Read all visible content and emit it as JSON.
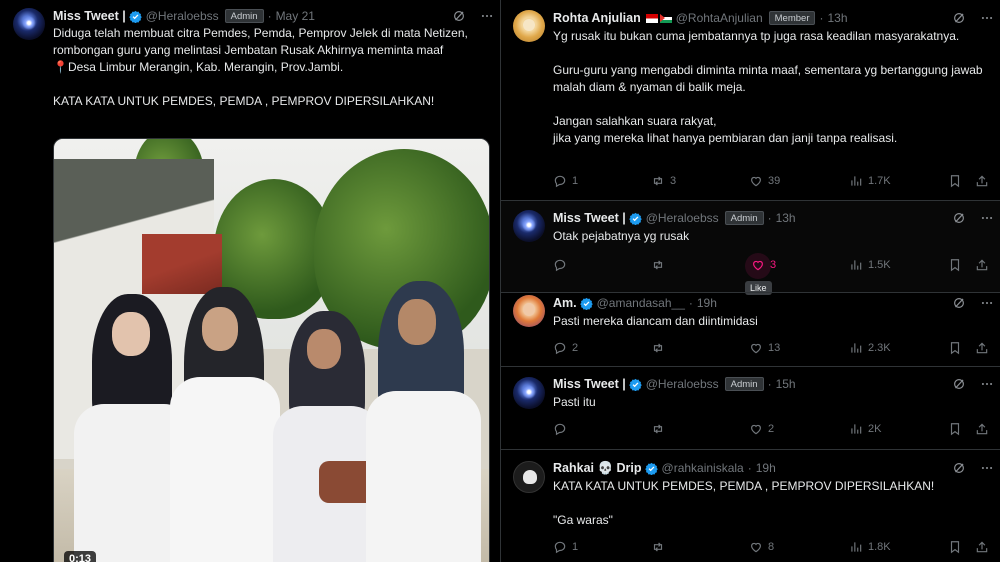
{
  "left_post": {
    "author_name": "Miss Tweet |",
    "handle": "@Heraloebss",
    "badge": "Admin",
    "time": "May 21",
    "text": "Diduga telah membuat citra Pemdes, Pemda, Pemprov Jelek di mata Netizen,  rombongan guru yang melintasi Jembatan Rusak Akhirnya meminta maaf\n📍Desa Limbur Merangin, Kab. Merangin, Prov.Jambi.\n\nKATA KATA UNTUK PEMDES, PEMDA , PEMPROV DIPERSILAHKAN!",
    "video_time": "0:13"
  },
  "replies": [
    {
      "author_name": "Rohta Anjulian",
      "handle": "@RohtaAnjulian",
      "badge": "Member",
      "time": "13h",
      "text": "Yg rusak itu bukan cuma jembatannya tp juga rasa keadilan masyarakatnya.\n\nGuru-guru yang mengabdi diminta minta maaf, sementara yg bertanggung jawab malah diam & nyaman di balik meja.\n\nJangan salahkan suara rakyat,\njika yang mereka lihat hanya pembiaran dan janji tanpa realisasi.",
      "replies": "1",
      "reposts": "3",
      "likes": "39",
      "views": "1.7K"
    },
    {
      "author_name": "Miss Tweet |",
      "handle": "@Heraloebss",
      "badge": "Admin",
      "time": "13h",
      "text": "Otak pejabatnya yg rusak",
      "replies": "",
      "reposts": "",
      "likes": "3",
      "views": "1.5K",
      "tooltip": "Like"
    },
    {
      "author_name": "Am.",
      "handle": "@amandasah__",
      "badge": "",
      "time": "19h",
      "text": "Pasti mereka diancam dan diintimidasi",
      "replies": "2",
      "reposts": "",
      "likes": "13",
      "views": "2.3K"
    },
    {
      "author_name": "Miss Tweet |",
      "handle": "@Heraloebss",
      "badge": "Admin",
      "time": "15h",
      "text": "Pasti itu",
      "replies": "",
      "reposts": "",
      "likes": "2",
      "views": "2K"
    },
    {
      "author_name": "Rahkai 💀 Drip",
      "handle": "@rahkainiskala",
      "badge": "",
      "time": "19h",
      "text": "KATA KATA UNTUK PEMDES, PEMDA , PEMPROV DIPERSILAHKAN!\n\n\"Ga waras\"",
      "replies": "1",
      "reposts": "",
      "likes": "8",
      "views": "1.8K"
    }
  ],
  "colors": {
    "background": "#000000",
    "text": "#e7e9ea",
    "muted": "#71767b",
    "verified": "#1d9bf0",
    "like_active": "#f91880",
    "divider": "#2f3336"
  },
  "icons": [
    "grok-icon",
    "more-icon",
    "reply-icon",
    "repost-icon",
    "like-icon",
    "views-icon",
    "bookmark-icon",
    "share-icon",
    "verified-icon"
  ]
}
